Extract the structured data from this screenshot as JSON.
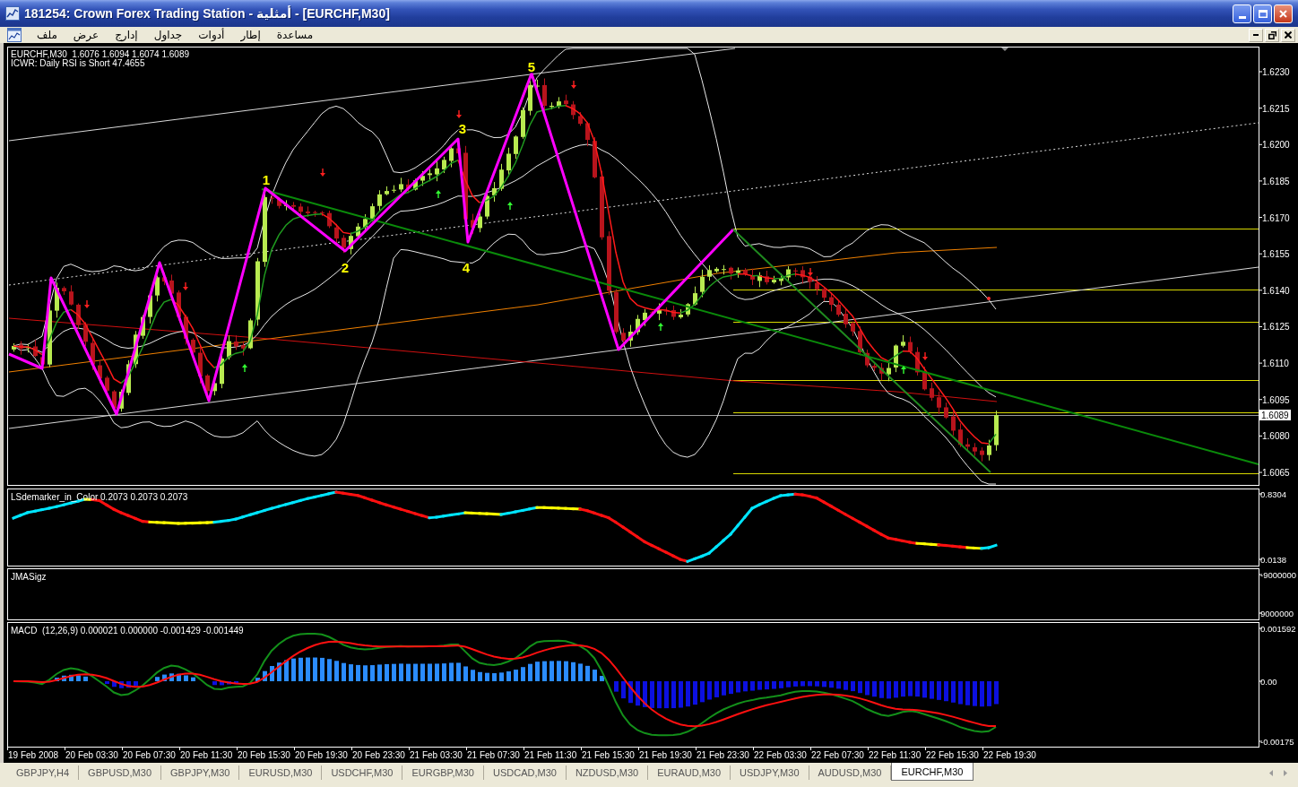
{
  "window": {
    "title": "181254: Crown Forex Trading Station - أمثلية - [EURCHF,M30]",
    "menu": [
      "مساعدة",
      "إطار",
      "أدوات",
      "جداول",
      "إدارج",
      "عرض",
      "ملف"
    ]
  },
  "chart": {
    "symbol_line": "EURCHF,M30  1.6076 1.6094 1.6074 1.6089",
    "signal_line": "ICWR: Daily RSI is Short 47.4655",
    "wave_labels": [
      "1",
      "2",
      "3",
      "4",
      "5"
    ],
    "price_axis": [
      "1.6230",
      "1.6215",
      "1.6200",
      "1.6185",
      "1.6170",
      "1.6155",
      "1.6140",
      "1.6125",
      "1.6110",
      "1.6095",
      "1.6080",
      "1.6065"
    ],
    "current_price": "1.6089"
  },
  "indicators": [
    {
      "kind": "demarker",
      "label": "LSdemarker_in_Color 0.2073 0.2073 0.2073",
      "axis": [
        "0.8304",
        "0.0138"
      ]
    },
    {
      "kind": "jma",
      "label": "JMASigz",
      "axis": [
        "-9000000",
        "9000000"
      ]
    },
    {
      "kind": "macd",
      "label": "MACD  (12,26,9) 0.000021 0.000000 -0.001429 -0.001449",
      "axis": [
        "0.001592",
        "0.00",
        "-0.00175"
      ]
    }
  ],
  "time_axis": [
    "19 Feb 2008",
    "20 Feb 03:30",
    "20 Feb 07:30",
    "20 Feb 11:30",
    "20 Feb 15:30",
    "20 Feb 19:30",
    "20 Feb 23:30",
    "21 Feb 03:30",
    "21 Feb 07:30",
    "21 Feb 11:30",
    "21 Feb 15:30",
    "21 Feb 19:30",
    "21 Feb 23:30",
    "22 Feb 03:30",
    "22 Feb 07:30",
    "22 Feb 11:30",
    "22 Feb 15:30",
    "22 Feb 19:30"
  ],
  "tabs": [
    {
      "label": "GBPJPY,H4",
      "selected": false
    },
    {
      "label": "GBPUSD,M30",
      "selected": false
    },
    {
      "label": "GBPJPY,M30",
      "selected": false
    },
    {
      "label": "EURUSD,M30",
      "selected": false
    },
    {
      "label": "USDCHF,M30",
      "selected": false
    },
    {
      "label": "EURGBP,M30",
      "selected": false
    },
    {
      "label": "USDCAD,M30",
      "selected": false
    },
    {
      "label": "NZDUSD,M30",
      "selected": false
    },
    {
      "label": "EURAUD,M30",
      "selected": false
    },
    {
      "label": "USDJPY,M30",
      "selected": false
    },
    {
      "label": "AUDUSD,M30",
      "selected": false
    },
    {
      "label": "EURCHF,M30",
      "selected": true
    }
  ]
}
